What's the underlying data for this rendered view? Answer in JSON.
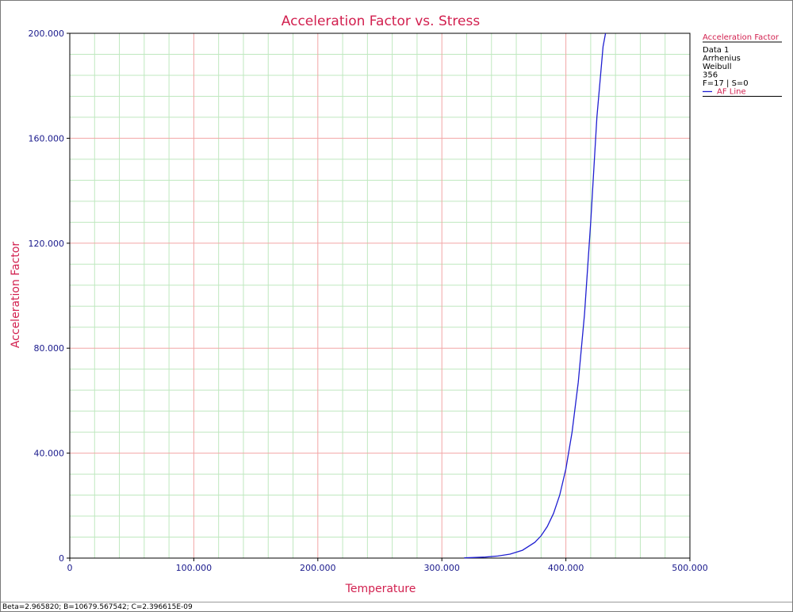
{
  "chart_data": {
    "type": "line",
    "title": "Acceleration Factor vs. Stress",
    "xlabel": "Temperature",
    "ylabel": "Acceleration Factor",
    "xlim": [
      0,
      500
    ],
    "ylim": [
      0,
      200
    ],
    "x_ticks": [
      0,
      100,
      200,
      300,
      400,
      500
    ],
    "x_tick_labels": [
      "0",
      "100.000",
      "200.000",
      "300.000",
      "400.000",
      "500.000"
    ],
    "y_ticks": [
      0,
      40,
      80,
      120,
      160,
      200
    ],
    "y_tick_labels": [
      "0",
      "40.000",
      "80.000",
      "120.000",
      "160.000",
      "200.000"
    ],
    "grid": true,
    "major_grid_color": "#f2a6a6",
    "minor_grid_color": "#bfe8bf",
    "series": [
      {
        "name": "AF Line",
        "color": "#1f1fd1",
        "x": [
          318,
          325,
          335,
          345,
          355,
          365,
          375,
          380,
          385,
          390,
          395,
          400,
          405,
          410,
          415,
          420,
          425,
          430,
          432
        ],
        "y": [
          0.1,
          0.2,
          0.4,
          0.8,
          1.5,
          3.0,
          6.0,
          8.5,
          12.0,
          17.0,
          24.0,
          34.0,
          48.0,
          67.0,
          93.0,
          128.0,
          168.0,
          195.0,
          200.0
        ]
      }
    ],
    "legend": {
      "placement": "top-right",
      "header": "Acceleration Factor",
      "lines": [
        "Data 1",
        "Arrhenius",
        "Weibull",
        "356",
        "F=17 | S=0"
      ]
    }
  },
  "status_bar": {
    "text": "Beta=2.965820; B=10679.567542; C=2.396615E-09"
  }
}
